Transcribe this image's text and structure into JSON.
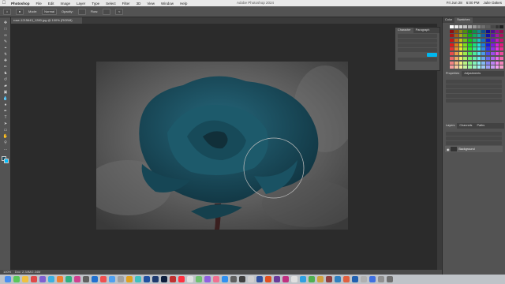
{
  "menubar": {
    "app": "Photoshop",
    "items": [
      "File",
      "Edit",
      "Image",
      "Layer",
      "Type",
      "Select",
      "Filter",
      "3D",
      "View",
      "Window",
      "Help"
    ],
    "window_title": "Adobe Photoshop 2024",
    "right": [
      "Fri Jun 28",
      "6:00 PM",
      "Julie Oakes"
    ]
  },
  "options": {
    "mode_label": "Mode:",
    "mode_value": "Normal",
    "opacity_label": "Opacity:",
    "flow_label": "Flow:"
  },
  "document": {
    "tab_title": "rose-1215643_1280.jpg @ 100% (RGB/8)"
  },
  "status": {
    "zoom": "100%",
    "doc_info": "Doc: 2.34M/2.34M"
  },
  "floating_panel": {
    "tabs": [
      "Character",
      "Paragraph"
    ]
  },
  "color_panel": {
    "tabs": [
      "Color",
      "Swatches"
    ]
  },
  "properties_panel": {
    "tabs": [
      "Properties",
      "Adjustments"
    ]
  },
  "layers_panel": {
    "tabs": [
      "Layers",
      "Channels",
      "Paths"
    ],
    "layers": [
      {
        "name": "Background"
      }
    ]
  },
  "colors": {
    "foreground": "#1c4a59",
    "background": "#00c0ff",
    "rose": "#1f5566"
  }
}
